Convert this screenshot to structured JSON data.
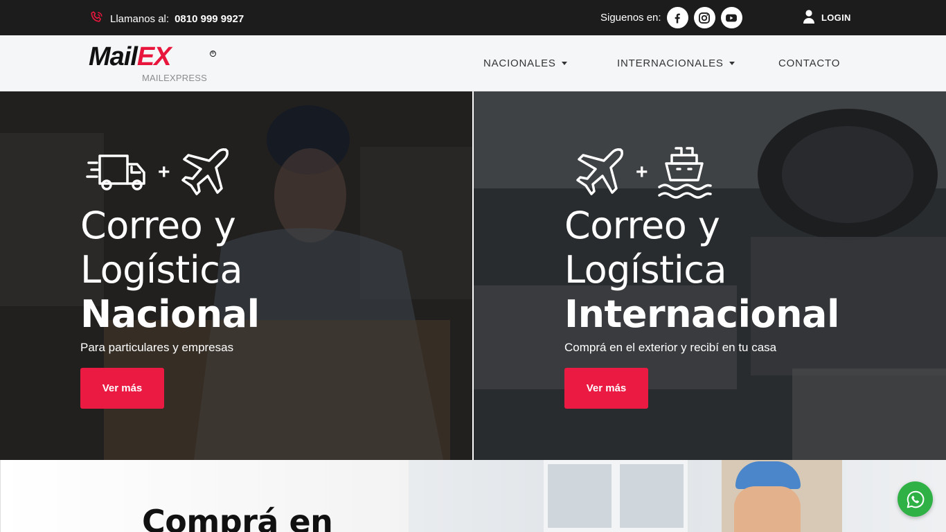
{
  "topbar": {
    "phone_label": "Llamanos al:",
    "phone_number": "0810 999 9927",
    "social_label": "Siguenos en:",
    "social_icons": [
      "facebook-icon",
      "instagram-icon",
      "youtube-icon"
    ],
    "login_label": "LOGIN"
  },
  "brand": {
    "logo_part1": "Mail",
    "logo_part2": "EX",
    "logo_registered": "®",
    "subtitle": "MAILEXPRESS"
  },
  "nav": {
    "items": [
      {
        "label": "NACIONALES",
        "has_dropdown": true
      },
      {
        "label": "INTERNACIONALES",
        "has_dropdown": true
      },
      {
        "label": "CONTACTO",
        "has_dropdown": false
      }
    ]
  },
  "hero": {
    "left": {
      "icons": [
        "truck-icon",
        "airplane-icon"
      ],
      "plus": "+",
      "line1": "Correo y",
      "line2": "Logística",
      "bold": "Nacional",
      "tagline": "Para particulares y empresas",
      "button": "Ver más"
    },
    "right": {
      "icons": [
        "airplane-icon",
        "ship-icon"
      ],
      "plus": "+",
      "line1": "Correo y",
      "line2": "Logística",
      "bold": "Internacional",
      "tagline": "Comprá en el exterior y recibí en tu casa",
      "button": "Ver más"
    }
  },
  "section2": {
    "headline": "Comprá en"
  },
  "colors": {
    "accent": "#ea1a42",
    "topbar_bg": "#1c1c1c",
    "nav_bg": "#f5f6f8",
    "whatsapp": "#2fb146"
  }
}
